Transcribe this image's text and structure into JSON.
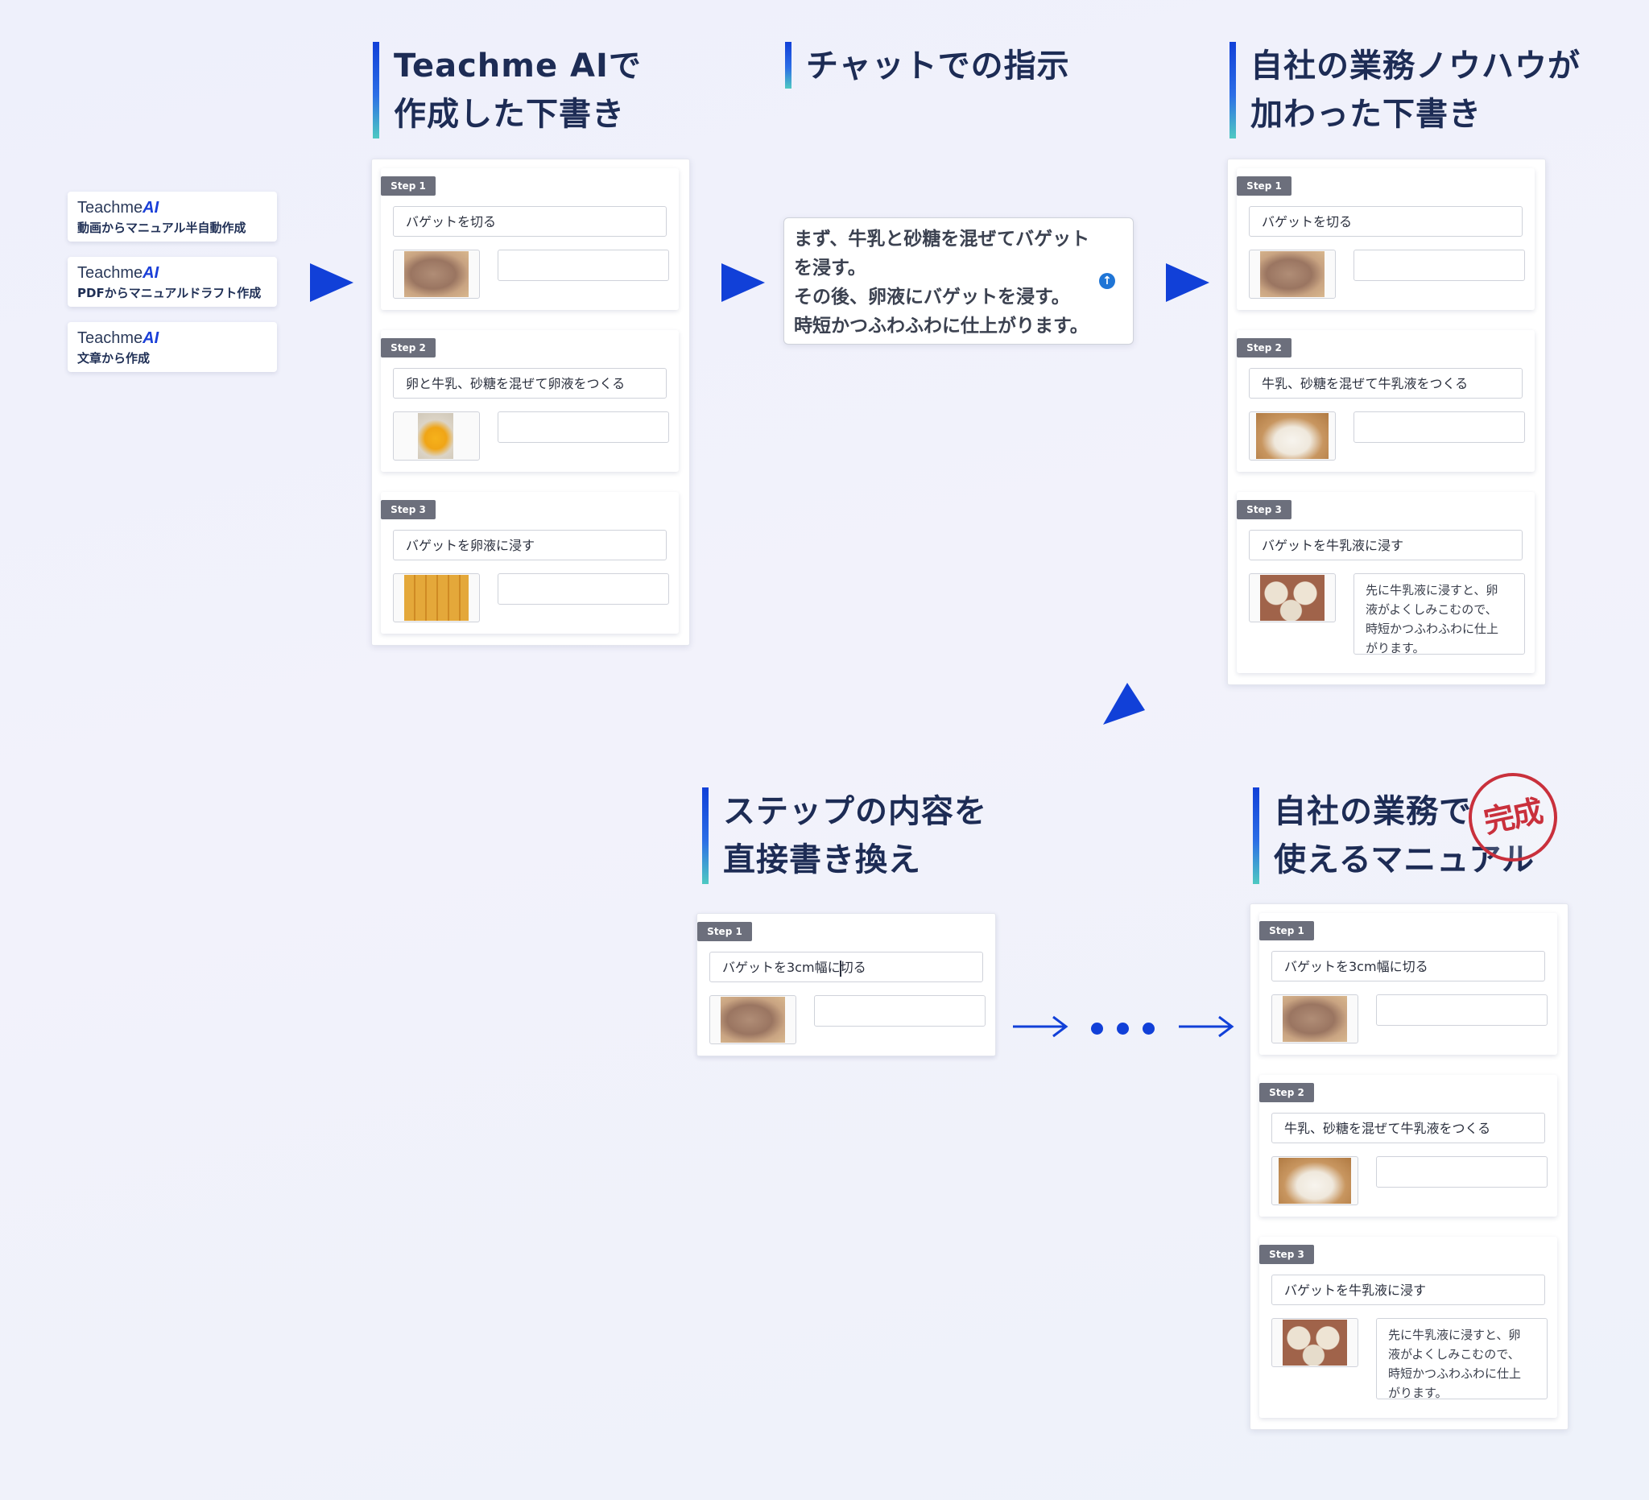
{
  "brand": {
    "prefix": "Teachme",
    "suffix": "AI"
  },
  "products": [
    {
      "desc": "動画からマニュアル半自動作成"
    },
    {
      "desc": "PDFからマニュアルドラフト作成"
    },
    {
      "desc": "文章から作成"
    }
  ],
  "headings": {
    "draft": [
      "Teachme AIで",
      "作成した下書き"
    ],
    "chat": [
      "チャットでの指示"
    ],
    "knowhow": [
      "自社の業務ノウハウが",
      "加わった下書き"
    ],
    "rewrite": [
      "ステップの内容を",
      "直接書き換え"
    ],
    "final": [
      "自社の業務で",
      "使えるマニュアル"
    ]
  },
  "stamp": "完成",
  "chat": {
    "lines": [
      "まず、牛乳と砂糖を混ぜてバゲット",
      "を浸す。",
      "その後、卵液にバゲットを浸す。",
      "時短かつふわふわに仕上がります。"
    ],
    "send_icon": "arrow-up-icon"
  },
  "draft_steps": [
    {
      "tag": "Step 1",
      "title": "バゲットを切る"
    },
    {
      "tag": "Step 2",
      "title": "卵と牛乳、砂糖を混ぜて卵液をつくる"
    },
    {
      "tag": "Step 3",
      "title": "バゲットを卵液に浸す"
    }
  ],
  "knowhow_steps": [
    {
      "tag": "Step 1",
      "title": "バゲットを切る"
    },
    {
      "tag": "Step 2",
      "title": "牛乳、砂糖を混ぜて牛乳液をつくる"
    },
    {
      "tag": "Step 3",
      "title": "バゲットを牛乳液に浸す",
      "note": [
        "先に牛乳液に浸すと、卵",
        "液がよくしみこむので、",
        "時短かつふわふわに仕上",
        "がります。"
      ]
    }
  ],
  "rewrite_step": {
    "tag": "Step 1",
    "title_before": "バゲットを3cm幅に",
    "title_after": "切る"
  },
  "final_steps": [
    {
      "tag": "Step 1",
      "title": "バゲットを3cm幅に切る"
    },
    {
      "tag": "Step 2",
      "title": "牛乳、砂糖を混ぜて牛乳液をつくる"
    },
    {
      "tag": "Step 3",
      "title": "バゲットを牛乳液に浸す",
      "note": [
        "先に牛乳液に浸すと、卵",
        "液がよくしみこむので、",
        "時短かつふわふわに仕上",
        "がります。"
      ]
    }
  ],
  "colors": {
    "accent": "#1140d8",
    "heading": "#1d2c55",
    "stamp": "#c9303c",
    "tag": "#6c6f7c"
  }
}
